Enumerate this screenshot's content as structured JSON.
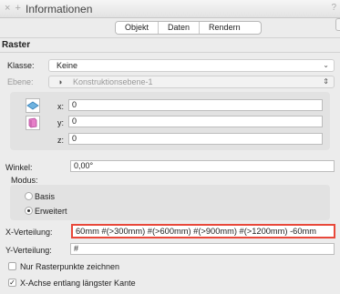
{
  "window": {
    "title": "Informationen",
    "help": "?"
  },
  "tabs": [
    "Objekt",
    "Daten",
    "Rendern"
  ],
  "section": {
    "title": "Raster"
  },
  "klasse": {
    "label": "Klasse:",
    "value": "Keine"
  },
  "ebene": {
    "label": "Ebene:",
    "value": "Konstruktionsebene-1"
  },
  "coords": {
    "x": {
      "label": "x:",
      "value": "0"
    },
    "y": {
      "label": "y:",
      "value": "0"
    },
    "z": {
      "label": "z:",
      "value": "0"
    }
  },
  "winkel": {
    "label": "Winkel:",
    "value": "0,00°"
  },
  "modus": {
    "label": "Modus:",
    "options": [
      {
        "label": "Basis",
        "selected": false
      },
      {
        "label": "Erweitert",
        "selected": true
      }
    ]
  },
  "x_verteilung": {
    "label": "X-Verteilung:",
    "value": "60mm #(>300mm) #(>600mm) #(>900mm) #(>1200mm) -60mm"
  },
  "y_verteilung": {
    "label": "Y-Verteilung:",
    "value": "#"
  },
  "checkboxes": [
    {
      "label": "Nur Rasterpunkte zeichnen",
      "checked": false
    },
    {
      "label": "X-Achse entlang längster Kante",
      "checked": true
    }
  ],
  "colors": {
    "highlight": "#e8483a",
    "panel": "#ececec"
  }
}
